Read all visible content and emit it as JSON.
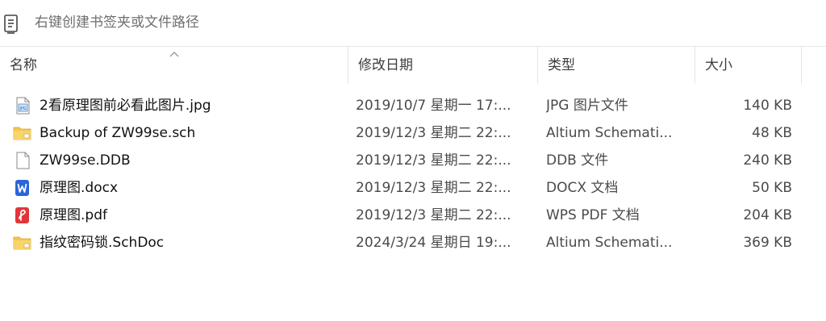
{
  "bookmark_bar": {
    "placeholder": "右键创建书签夹或文件路径",
    "icon": "bookmark-list-icon"
  },
  "columns": {
    "name": "名称",
    "date": "修改日期",
    "type": "类型",
    "size": "大小",
    "sort_icon": "sort-ascending-icon"
  },
  "files": [
    {
      "name": "2看原理图前必看此图片.jpg",
      "date": "2019/10/7 星期一 17:...",
      "type": "JPG 图片文件",
      "size": "140 KB",
      "icon": "jpg-image-icon"
    },
    {
      "name": "Backup of ZW99se.sch",
      "date": "2019/12/3 星期二 22:...",
      "type": "Altium Schemati...",
      "size": "48 KB",
      "icon": "schematic-file-icon"
    },
    {
      "name": "ZW99se.DDB",
      "date": "2019/12/3 星期二 22:...",
      "type": "DDB 文件",
      "size": "240 KB",
      "icon": "blank-file-icon"
    },
    {
      "name": "原理图.docx",
      "date": "2019/12/3 星期二 22:...",
      "type": "DOCX 文档",
      "size": "50 KB",
      "icon": "word-doc-icon"
    },
    {
      "name": "原理图.pdf",
      "date": "2019/12/3 星期二 22:...",
      "type": "WPS PDF 文档",
      "size": "204 KB",
      "icon": "pdf-file-icon"
    },
    {
      "name": "指纹密码锁.SchDoc",
      "date": "2024/3/24 星期日 19:...",
      "type": "Altium Schemati...",
      "size": "369 KB",
      "icon": "schematic-file-icon"
    }
  ],
  "colors": {
    "word_blue": "#2b65d9",
    "pdf_red": "#e2353a",
    "folder_yellow": "#f5c54a"
  }
}
